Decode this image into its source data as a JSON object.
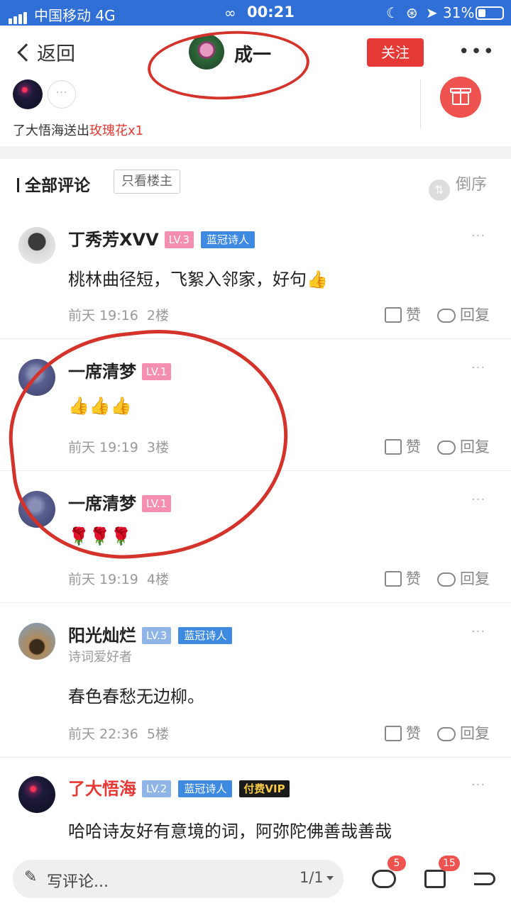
{
  "status_bar": {
    "carrier": "中国移动  4G",
    "time": "00:21",
    "battery": "31%",
    "battery_level": 0.31,
    "icons": [
      "signal-icon",
      "link-icon",
      "moon-icon",
      "rotation-lock-icon",
      "location-icon",
      "battery-icon"
    ]
  },
  "header": {
    "back_label": "返回",
    "author_name": "成一",
    "follow_label": "关注",
    "more_label": "•••"
  },
  "gifts": {
    "more_label": "···",
    "sender": "了大悟海送出",
    "gift_name": "玫瑰花x1"
  },
  "comments_header": {
    "title": "全部评论",
    "owner_only": "只看楼主",
    "reverse_icon": "⇅",
    "reverse_label": "倒序"
  },
  "comments": [
    {
      "name": "丁秀芳XVV",
      "level": "LV.3",
      "badge": "蓝冠诗人",
      "text": "桃林曲径短，飞絮入邻家，好句",
      "emoji": "👍",
      "time": "前天 19:16",
      "floor": "2楼",
      "like": "赞",
      "reply": "回复"
    },
    {
      "name": "一席清梦",
      "level": "LV.1",
      "emoji": "👍👍👍",
      "time": "前天 19:19",
      "floor": "3楼",
      "like": "赞",
      "reply": "回复"
    },
    {
      "name": "一席清梦",
      "level": "LV.1",
      "emoji": "🌹🌹🌹",
      "time": "前天 19:19",
      "floor": "4楼",
      "like": "赞",
      "reply": "回复"
    },
    {
      "name": "阳光灿烂",
      "level": "LV.3",
      "badge": "蓝冠诗人",
      "subtitle": "诗词爱好者",
      "text": "春色春愁无边柳。",
      "time": "前天 22:36",
      "floor": "5楼",
      "like": "赞",
      "reply": "回复"
    },
    {
      "name": "了大悟海",
      "level": "LV.2",
      "badge": "蓝冠诗人",
      "vip": "付费VIP",
      "text": "哈哈诗友好有意境的词，阿弥陀佛善哉善哉"
    }
  ],
  "bottom_bar": {
    "pen_icon": "✎",
    "placeholder": "写评论...",
    "page": "1/1",
    "comment_count": "5",
    "like_count": "15"
  },
  "colors": {
    "status_bar": "#2f6fd6",
    "accent_red": "#e53935",
    "annotation_red": "#d4332b",
    "badge_blue": "#3d8ae0",
    "level_pink": "#f48fb1"
  }
}
